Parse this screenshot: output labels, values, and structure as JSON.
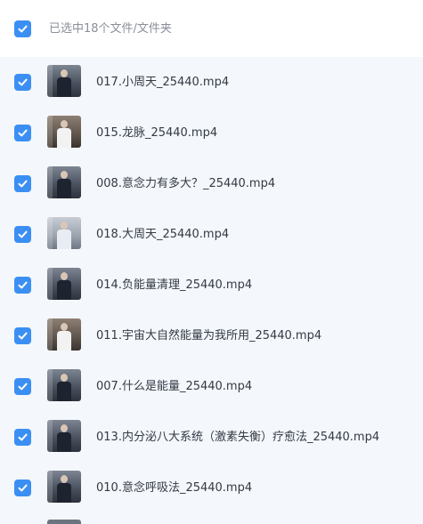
{
  "header": {
    "selection_text": "已选中18个文件/文件夹"
  },
  "colors": {
    "checkbox": "#3b8ff3",
    "list_background": "#f4f7fb",
    "header_text": "#8a8f99",
    "filename_text": "#333a45"
  },
  "files": [
    {
      "name": "017.小周天_25440.mp4",
      "checked": true,
      "icon": "video-thumbnail"
    },
    {
      "name": "015.龙脉_25440.mp4",
      "checked": true,
      "icon": "video-thumbnail"
    },
    {
      "name": "008.意念力有多大？_25440.mp4",
      "checked": true,
      "icon": "video-thumbnail"
    },
    {
      "name": "018.大周天_25440.mp4",
      "checked": true,
      "icon": "video-thumbnail"
    },
    {
      "name": "014.负能量清理_25440.mp4",
      "checked": true,
      "icon": "video-thumbnail"
    },
    {
      "name": "011.宇宙大自然能量为我所用_25440.mp4",
      "checked": true,
      "icon": "video-thumbnail"
    },
    {
      "name": "007.什么是能量_25440.mp4",
      "checked": true,
      "icon": "video-thumbnail"
    },
    {
      "name": "013.内分泌八大系统（激素失衡）疗愈法_25440.mp4",
      "checked": true,
      "icon": "video-thumbnail"
    },
    {
      "name": "010.意念呼吸法_25440.mp4",
      "checked": true,
      "icon": "video-thumbnail"
    }
  ]
}
